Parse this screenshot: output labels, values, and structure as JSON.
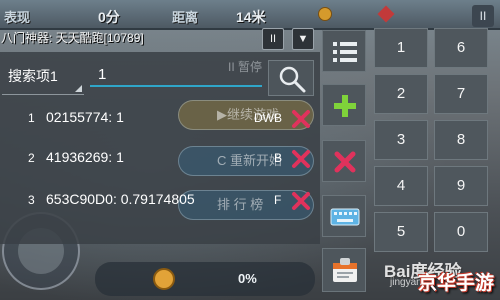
{
  "game": {
    "label_score": "表现",
    "score_value": "0分",
    "label_distance": "距离",
    "distance_value": "14米",
    "pause_icon": "pause-icon",
    "bottom_percent": "0%"
  },
  "app": {
    "title": "八门神器: 天天酷跑[10789]",
    "pause_button": "II",
    "collapse_button": "▼"
  },
  "search": {
    "label": "搜索项1",
    "value": "1",
    "ghost_text": "II 暂停"
  },
  "results": [
    {
      "index": "1",
      "value": "02155774: 1",
      "tag": "DWB"
    },
    {
      "index": "2",
      "value": "41936269: 1",
      "tag": "B"
    },
    {
      "index": "3",
      "value": "653C90D0: 0.79174805",
      "tag": "F"
    }
  ],
  "game_buttons": [
    "▶继续游戏",
    "C 重新开始",
    "排 行 榜"
  ],
  "keypad": {
    "left_column": [
      "1",
      "2",
      "3",
      "4",
      "5"
    ],
    "right_column": [
      "6",
      "7",
      "8",
      "9",
      "0"
    ]
  },
  "tools": [
    "list-icon",
    "add-icon",
    "delete-icon",
    "keyboard-icon",
    "app-icon"
  ],
  "watermark": {
    "baidu": "Bai度经验",
    "jingyan": "jingyan",
    "site": "京华手游"
  },
  "colors": {
    "accent_blue": "#2fa6c9",
    "delete_red": "#e0325c",
    "add_green": "#7fd33a"
  }
}
